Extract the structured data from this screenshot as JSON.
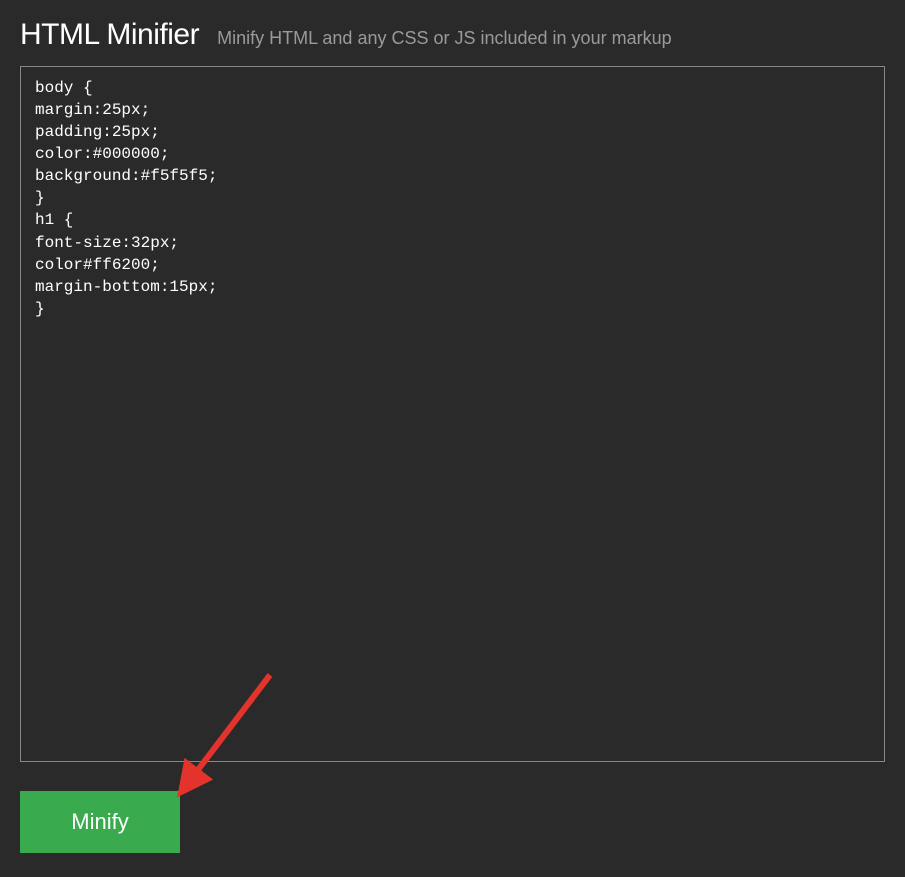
{
  "header": {
    "title": "HTML Minifier",
    "subtitle": "Minify HTML and any CSS or JS included in your markup"
  },
  "editor": {
    "value": "body {\nmargin:25px;\npadding:25px;\ncolor:#000000;\nbackground:#f5f5f5;\n}\nh1 {\nfont-size:32px;\ncolor#ff6200;\nmargin-bottom:15px;\n}"
  },
  "button": {
    "minify_label": "Minify"
  },
  "annotation": {
    "arrow_color": "#e3332c"
  }
}
